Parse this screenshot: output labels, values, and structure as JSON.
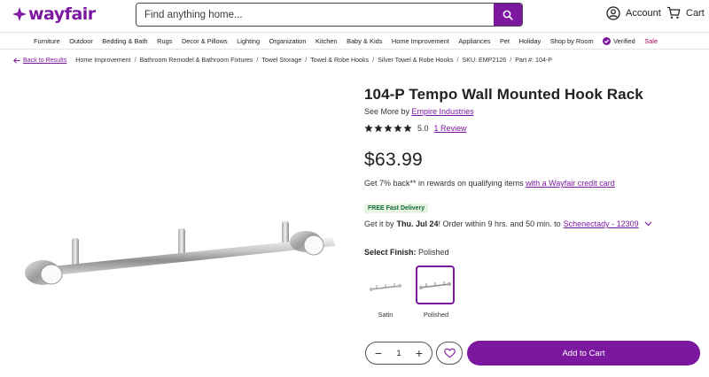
{
  "brand": {
    "name": "wayfair",
    "color": "#7b189f"
  },
  "search": {
    "placeholder": "Find anything home..."
  },
  "header": {
    "account_label": "Account",
    "cart_label": "Cart"
  },
  "nav": {
    "items": [
      "Furniture",
      "Outdoor",
      "Bedding & Bath",
      "Rugs",
      "Decor & Pillows",
      "Lighting",
      "Organization",
      "Kitchen",
      "Baby & Kids",
      "Home Improvement",
      "Appliances",
      "Pet",
      "Holiday",
      "Shop by Room"
    ],
    "verified": "Verified",
    "sale": "Sale"
  },
  "breadcrumbs": {
    "back": "Back to Results",
    "items": [
      "Home Improvement",
      "Bathroom Remodel & Bathroom Fixtures",
      "Towel Storage",
      "Towel & Robe Hooks",
      "Silver Towel & Robe Hooks"
    ],
    "sku": "SKU: EMP2126",
    "part": "Part #: 104-P"
  },
  "product": {
    "title": "104-P Tempo Wall Mounted Hook Rack",
    "see_more_prefix": "See More by",
    "brand": "Empire Industries",
    "rating": 5.0,
    "rating_text": "5.0",
    "review_link": "1 Review",
    "price": "$63.99",
    "rewards_text": "Get 7% back** in rewards on qualifying items",
    "rewards_link": "with a Wayfair credit card",
    "badge": "FREE Fast Delivery",
    "delivery_prefix": "Get it by",
    "delivery_date": "Thu. Jul 24",
    "delivery_mid": "! Order within 9 hrs. and 50 min. to",
    "delivery_location": "Schenectady - 12309",
    "finish_label": "Select Finish:",
    "finish_selected": "Polished",
    "finishes": [
      "Satin",
      "Polished"
    ]
  },
  "buy": {
    "quantity": "1",
    "add_to_cart": "Add to Cart"
  }
}
